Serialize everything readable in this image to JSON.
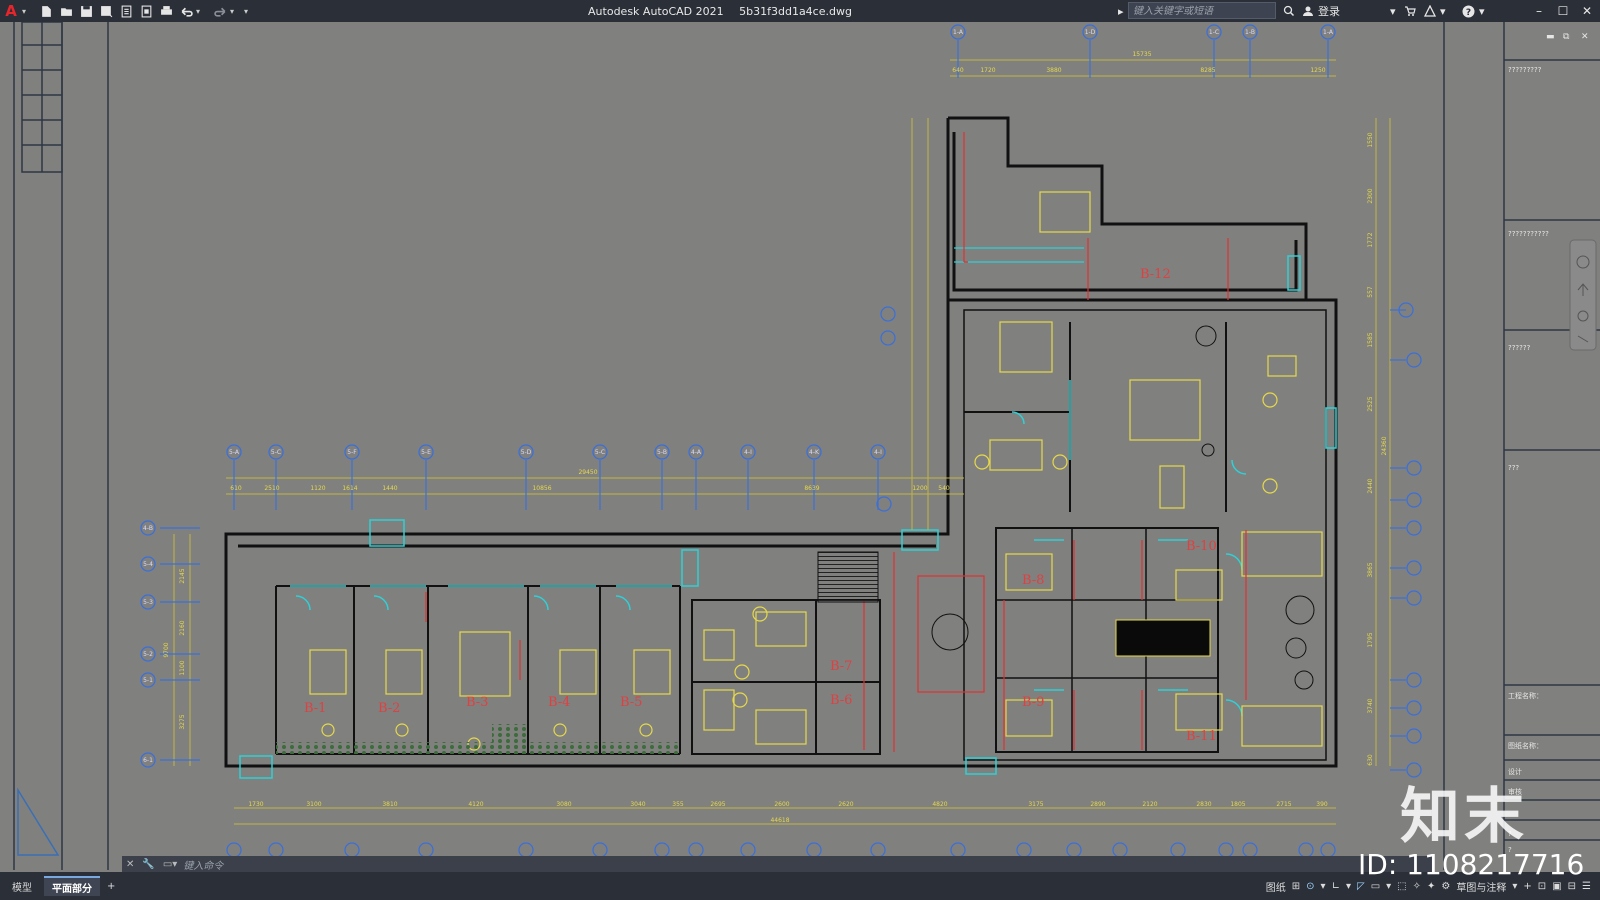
{
  "titlebar": {
    "app_name": "Autodesk AutoCAD 2021",
    "file_name": "5b31f3dd1a4ce.dwg",
    "search_placeholder": "键入关键字或短语",
    "login_label": "登录"
  },
  "drawing": {
    "room_labels": [
      "B-1",
      "B-2",
      "B-3",
      "B-4",
      "B-5",
      "B-6",
      "B-7",
      "B-8",
      "B-9",
      "B-10",
      "B-11",
      "B-12"
    ],
    "top_axis_labels": [
      "1-A",
      "1-D",
      "1-C",
      "1-B",
      "1-A"
    ],
    "top_dimensions": [
      "15735",
      "640",
      "1720",
      "3880",
      "8285",
      "1250"
    ],
    "mid_axis_labels": [
      "5-A",
      "5-C",
      "5-F",
      "5-E",
      "5-D",
      "5-C",
      "5-B",
      "4-A",
      "4-I",
      "4-K",
      "4-I"
    ],
    "mid_dimensions": [
      "29450",
      "610",
      "2510",
      "1120",
      "1614",
      "1440",
      "10856",
      "8639",
      "1200",
      "540"
    ],
    "left_axis_labels": [
      "4-B",
      "5-4",
      "5-3",
      "5-2",
      "5-1",
      "6-1"
    ],
    "left_dimensions": [
      "2145",
      "2160",
      "9700",
      "1100",
      "3275"
    ],
    "bottom_dimensions": [
      "1730",
      "3100",
      "3810",
      "4120",
      "3080",
      "3040",
      "355",
      "2695",
      "2600",
      "2620",
      "4820",
      "3175",
      "2890",
      "2120",
      "2830",
      "1805",
      "2715",
      "390",
      "44618"
    ],
    "right_dimensions": [
      "1550",
      "2300",
      "1772",
      "557",
      "1585",
      "2525",
      "24360",
      "2440",
      "3865",
      "1795",
      "3740",
      "630"
    ]
  },
  "command_line": {
    "placeholder": "键入命令"
  },
  "status": {
    "tabs": [
      "模型",
      "平面部分"
    ],
    "paper_label": "图纸",
    "workspace_label": "草图与注释"
  },
  "side_panel": {
    "notes": [
      "?????????",
      "???????????",
      "??????",
      "???",
      "工程名称：",
      "图纸名称：",
      "设计",
      "审核",
      "?",
      "?"
    ]
  },
  "watermark": {
    "text": "知末",
    "id": "ID: 1108217716"
  }
}
